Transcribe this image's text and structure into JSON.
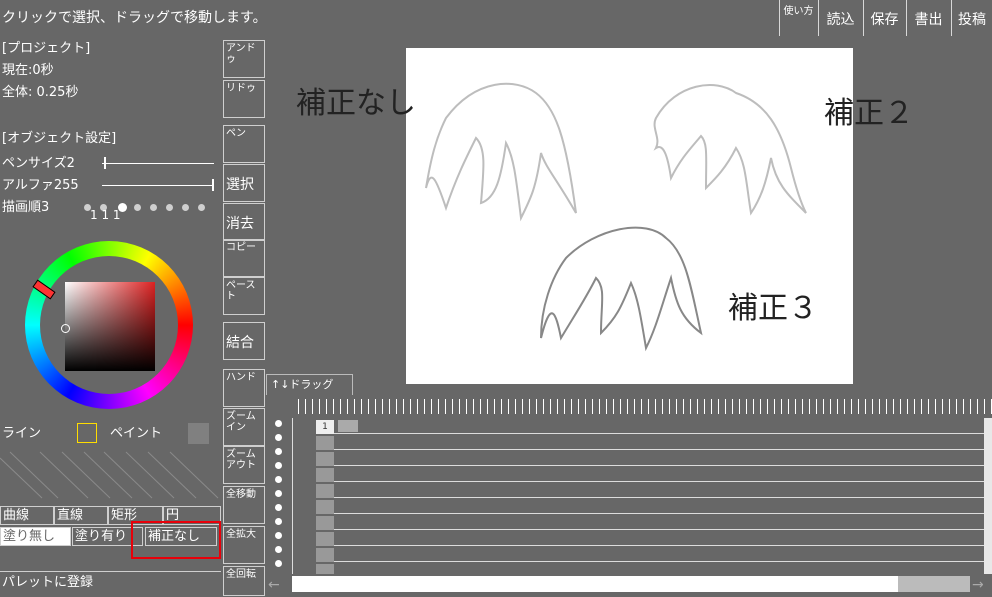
{
  "status": {
    "hint": "クリックで選択、ドラッグで移動します。"
  },
  "topmenu": {
    "howto": "使い方",
    "load": "読込",
    "save": "保存",
    "export": "書出",
    "post": "投稿"
  },
  "project": {
    "header": "[プロジェクト]",
    "current": "現在:0秒",
    "total": "全体: 0.25秒"
  },
  "object": {
    "header": "[オブジェクト設定]",
    "pen_size": "ペンサイズ2",
    "alpha": "アルファ255",
    "draw_order": "描画順3",
    "order_marks": "1 1 1"
  },
  "colors": {
    "line_label": "ライン",
    "paint_label": "ペイント",
    "line_color": "#ffdd00",
    "paint_color": "#808080"
  },
  "tools": {
    "undo": "アンドゥ",
    "redo": "リドゥ",
    "pen": "ペン",
    "select": "選択",
    "erase": "消去",
    "copy": "コピー",
    "paste": "ペースト",
    "merge": "結合",
    "hand": "ハンド",
    "zoom_in": "ズーム イン",
    "zoom_out": "ズーム アウト",
    "move_all": "全移動",
    "enlarge_all": "全拡大",
    "rotate_all": "全回転"
  },
  "modes": {
    "curve": "曲線",
    "line": "直線",
    "rect": "矩形",
    "circle": "円",
    "no_fill": "塗り無し",
    "fill": "塗り有り",
    "correction": "補正なし"
  },
  "palette": {
    "register": "パレットに登録"
  },
  "canvas": {
    "label1": "補正なし",
    "label2": "補正２",
    "label3": "補正３"
  },
  "timeline": {
    "tab": "↑↓ドラッグ",
    "cell_label": "1"
  }
}
